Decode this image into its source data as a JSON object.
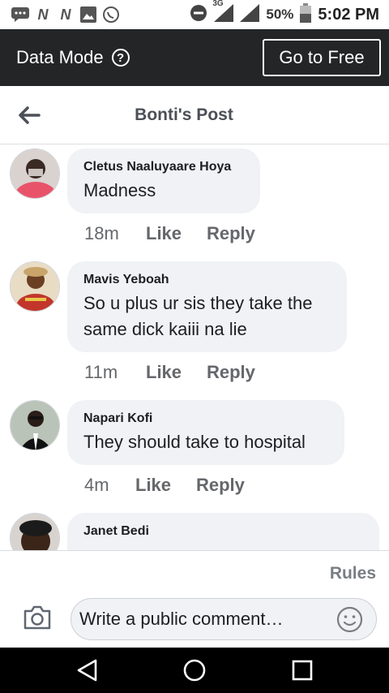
{
  "status_bar": {
    "battery": "50%",
    "time": "5:02 PM",
    "network": "3G",
    "icons": [
      "messages-icon",
      "n-app-icon",
      "n-app-icon",
      "gallery-icon",
      "whatsapp-icon",
      "do-not-disturb-icon",
      "signal-icon",
      "signal-icon",
      "battery-icon"
    ]
  },
  "banner": {
    "title": "Data Mode",
    "help": "?",
    "button": "Go to Free"
  },
  "header": {
    "title": "Bonti's Post"
  },
  "comments": [
    {
      "name": "Cletus Naaluyaare Hoya",
      "text": "Madness",
      "time": "18m",
      "like": "Like",
      "reply": "Reply"
    },
    {
      "name": "Mavis Yeboah",
      "text": "So u plus ur sis they take the same dick kaiii na lie",
      "time": "11m",
      "like": "Like",
      "reply": "Reply"
    },
    {
      "name": "Napari Kofi",
      "text": "They should take to hospital",
      "time": "4m",
      "like": "Like",
      "reply": "Reply"
    },
    {
      "name": "Janet Bedi",
      "text": ""
    }
  ],
  "footer": {
    "rules": "Rules",
    "comment_placeholder": "Write a public comment…"
  },
  "colors": {
    "banner_bg": "#242526",
    "bubble_bg": "#f0f2f5",
    "muted_text": "#65676b"
  }
}
